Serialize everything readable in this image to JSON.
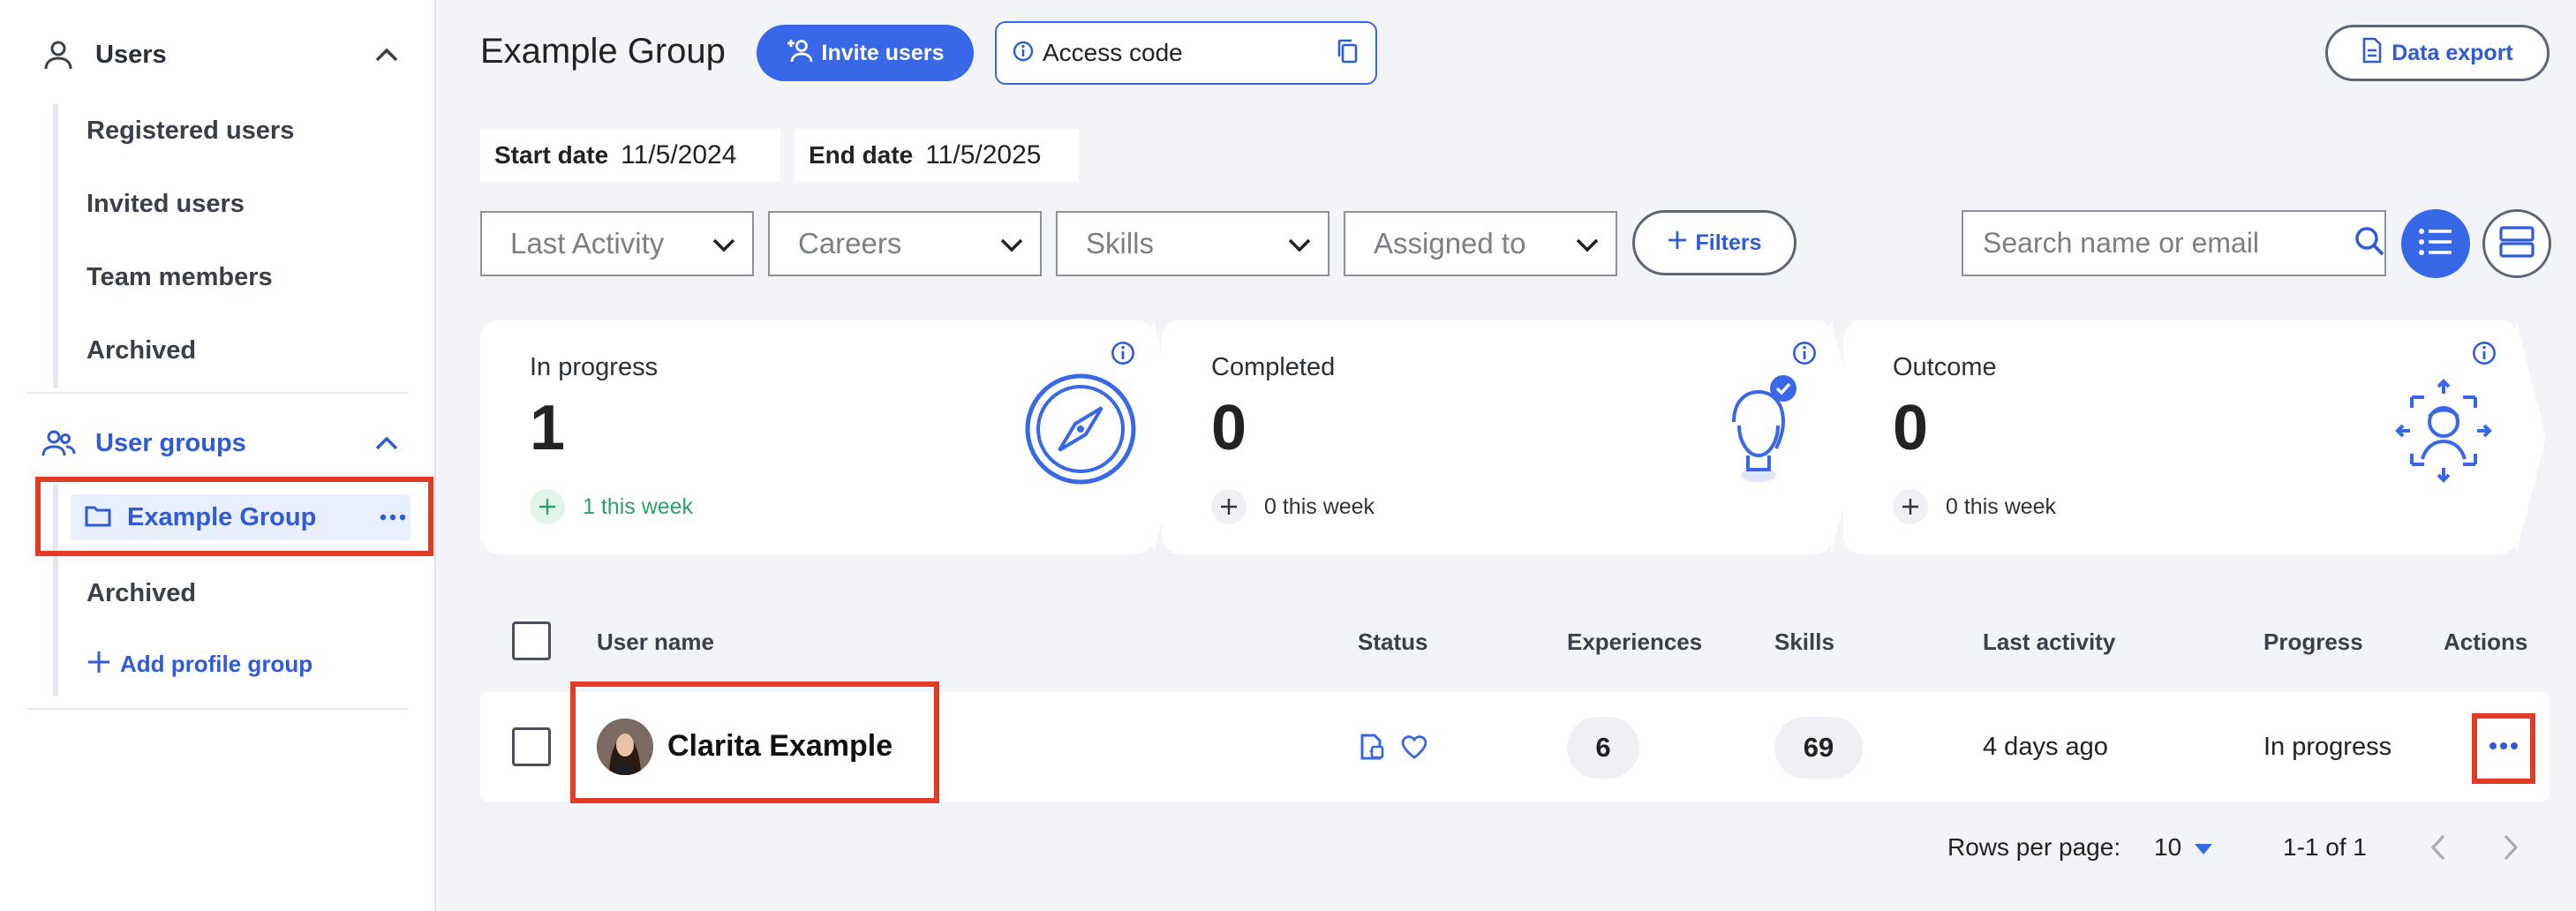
{
  "sidebar": {
    "users_section": "Users",
    "user_items": [
      "Registered users",
      "Invited users",
      "Team members",
      "Archived"
    ],
    "groups_section": "User groups",
    "active_group": "Example Group",
    "group_archived": "Archived",
    "add_group": "Add profile group"
  },
  "header": {
    "title": "Example Group",
    "invite_label": "Invite users",
    "access_label": "Access code",
    "export_label": "Data export"
  },
  "dates": {
    "start_label": "Start date",
    "start_value": "11/5/2024",
    "end_label": "End date",
    "end_value": "11/5/2025"
  },
  "filters": {
    "dropdowns": [
      "Last Activity",
      "Careers",
      "Skills",
      "Assigned to"
    ],
    "filters_label": "Filters",
    "search_placeholder": "Search name or email"
  },
  "stats": [
    {
      "label": "In progress",
      "value": "1",
      "week": "1 this week"
    },
    {
      "label": "Completed",
      "value": "0",
      "week": "0 this week"
    },
    {
      "label": "Outcome",
      "value": "0",
      "week": "0 this week"
    }
  ],
  "table": {
    "headers": [
      "User name",
      "Status",
      "Experiences",
      "Skills",
      "Last activity",
      "Progress",
      "Actions"
    ],
    "rows": [
      {
        "name": "Clarita Example",
        "experiences": "6",
        "skills": "69",
        "last_activity": "4 days ago",
        "progress": "In progress"
      }
    ]
  },
  "pagination": {
    "rows_label": "Rows per page:",
    "rows_value": "10",
    "range": "1-1 of 1"
  },
  "colors": {
    "primary": "#3868e8",
    "accent_text": "#2f5bd7",
    "highlight": "#e23b25",
    "positive": "#2ea16a"
  }
}
